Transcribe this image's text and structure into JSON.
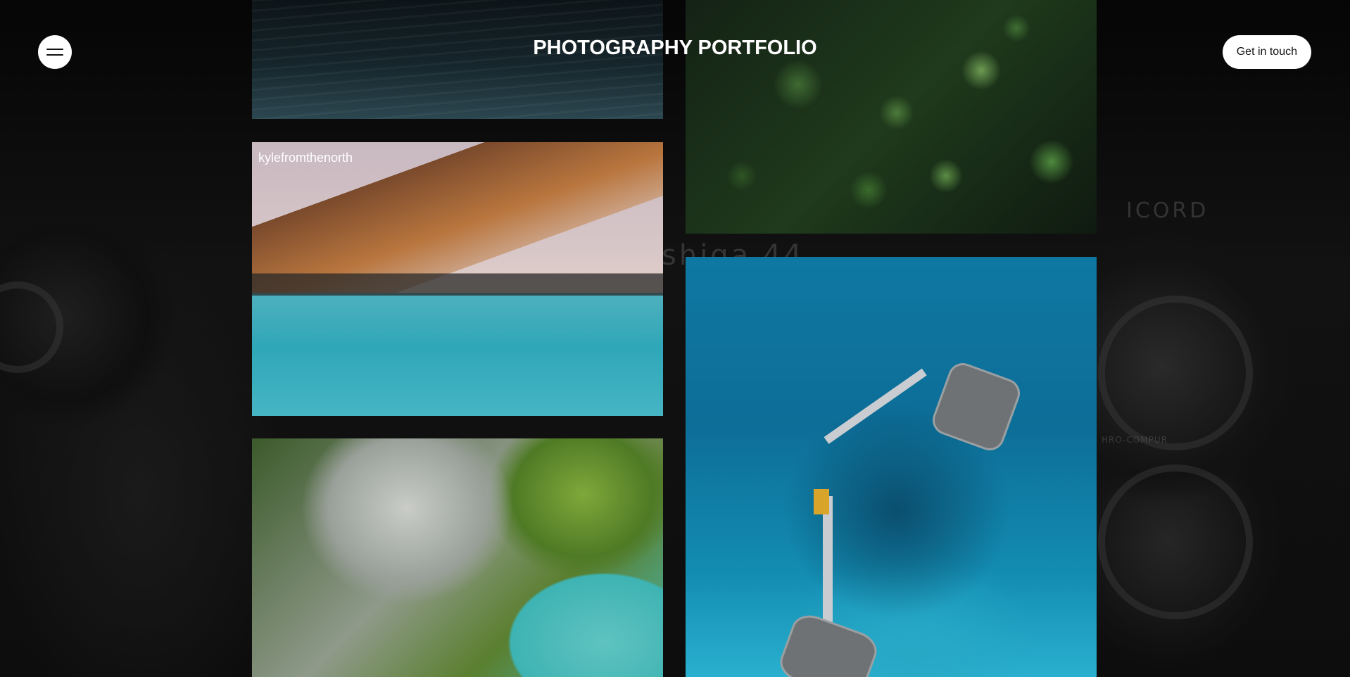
{
  "header": {
    "title": "PHOTOGRAPHY PORTFOLIO",
    "cta_label": "Get in touch"
  },
  "menu": {
    "icon": "hamburger-menu-icon"
  },
  "background": {
    "camera_text_1": "ICORD",
    "camera_text_2": "shiga 44",
    "camera_text_3": "HRO-COMPUR"
  },
  "gallery": {
    "items": [
      {
        "id": "ocean",
        "caption": ""
      },
      {
        "id": "forest",
        "caption": ""
      },
      {
        "id": "beach",
        "caption": "kylefromthenorth"
      },
      {
        "id": "lake",
        "caption": ""
      },
      {
        "id": "bungalow",
        "caption": ""
      }
    ]
  },
  "colors": {
    "background": "#0b0b0b",
    "button_bg": "#ffffff",
    "text_light": "#ffffff"
  }
}
